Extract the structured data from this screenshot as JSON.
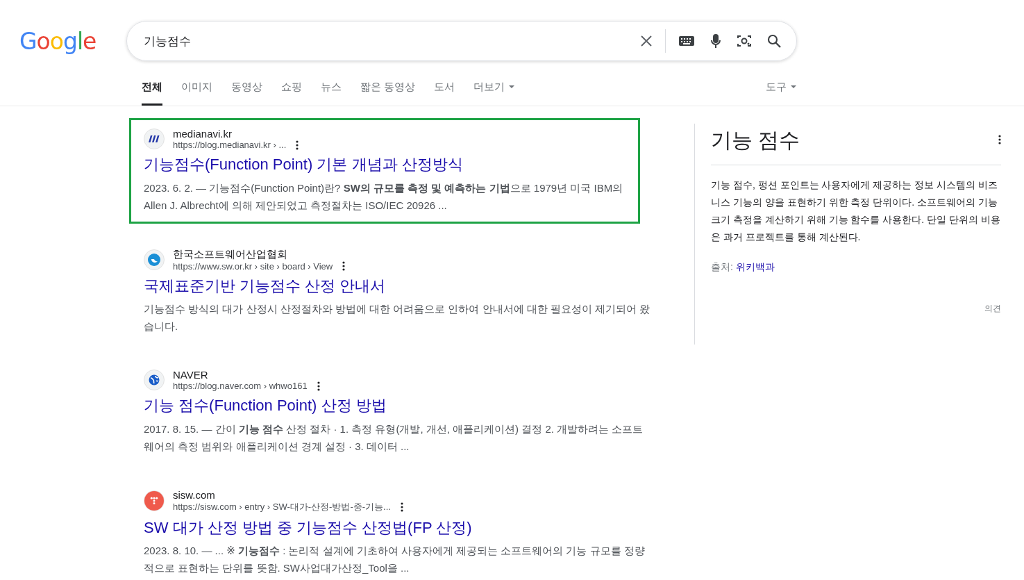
{
  "logo": {
    "text": "Google"
  },
  "search": {
    "value": "기능점수"
  },
  "tabs": [
    {
      "label": "전체",
      "selected": true,
      "dropdown": false
    },
    {
      "label": "이미지",
      "selected": false,
      "dropdown": false
    },
    {
      "label": "동영상",
      "selected": false,
      "dropdown": false
    },
    {
      "label": "쇼핑",
      "selected": false,
      "dropdown": false
    },
    {
      "label": "뉴스",
      "selected": false,
      "dropdown": false
    },
    {
      "label": "짧은 동영상",
      "selected": false,
      "dropdown": false
    },
    {
      "label": "도서",
      "selected": false,
      "dropdown": false
    },
    {
      "label": "더보기",
      "selected": false,
      "dropdown": true
    }
  ],
  "tools": {
    "label": "도구"
  },
  "results": [
    {
      "site": "medianavi.kr",
      "url": "https://blog.medianavi.kr › ...",
      "highlighted": true,
      "title": "기능점수(Function Point) 기본 개념과 산정방식",
      "snippet": "2023. 6. 2. — 기능점수(Function Point)란? **SW의 규모를 측정 및 예측하는 기법**으로 1979년 미국 IBM의 Allen J. Albrecht에 의해 제안되었고 측정절차는 ISO/IEC 20926 ..."
    },
    {
      "site": "한국소프트웨어산업협회",
      "url": "https://www.sw.or.kr › site › board › View",
      "highlighted": false,
      "title": "국제표준기반 기능점수 산정 안내서",
      "snippet": "기능점수 방식의 대가 산정시 산정절차와 방법에 대한 어려움으로 인하여 안내서에 대한 필요성이 제기되어 왔습니다."
    },
    {
      "site": "NAVER",
      "url": "https://blog.naver.com › whwo161",
      "highlighted": false,
      "title": "기능 점수(Function Point) 산정 방법",
      "snippet": "2017. 8. 15. — 간이 **기능 점수** 산정 절차 · 1. 측정 유형(개발, 개선, 애플리케이션) 결정 2. 개발하려는 소프트웨어의 측정 범위와 애플리케이션 경계 설정 · 3. 데이터 ..."
    },
    {
      "site": "sisw.com",
      "url": "https://sisw.com › entry › SW-대가-산정-방법-중-기능...",
      "highlighted": false,
      "title": "SW 대가 산정 방법 중 기능점수 산정법(FP 산정)",
      "snippet": "2023. 8. 10. — ... ※ **기능점수** : 논리적 설계에 기초하여 사용자에게 제공되는 소프트웨어의 기능 규모를 정량적으로 표현하는 단위를 뜻함. SW사업대가산정_Tool을 ..."
    }
  ],
  "knowledge_panel": {
    "title": "기능 점수",
    "description": "기능 점수, 펑션 포인트는 사용자에게 제공하는 정보 시스템의 비즈니스 기능의 양을 표현하기 위한 측정 단위이다. 소프트웨어의 기능 크기 측정을 계산하기 위해 기능 함수를 사용한다. 단일 단위의 비용은 과거 프로젝트를 통해 계산된다.",
    "source_label": "출처:",
    "source_link": "위키백과",
    "feedback": "의견"
  }
}
